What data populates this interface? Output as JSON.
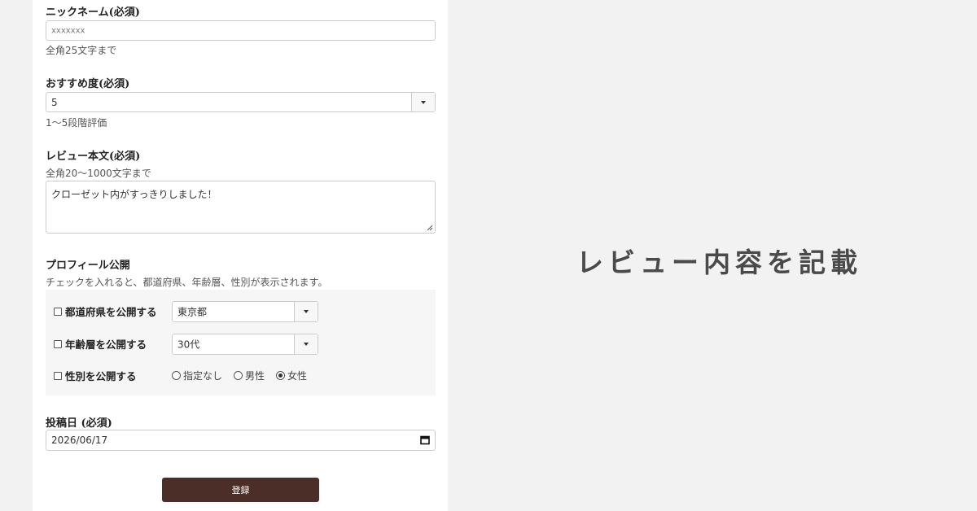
{
  "form": {
    "nickname": {
      "label": "ニックネーム(必須)",
      "placeholder": "xxxxxxx",
      "help": "全角25文字まで"
    },
    "rating": {
      "label": "おすすめ度(必須)",
      "value": "5",
      "help": "1〜5段階評価"
    },
    "review": {
      "label": "レビュー本文(必須)",
      "help": "全角20〜1000文字まで",
      "value": "クローゼット内がすっきりしました！"
    },
    "profile": {
      "label": "プロフィール公開",
      "help": "チェックを入れると、都道府県、年齢層、性別が表示されます。",
      "prefecture": {
        "label": "都道府県を公開する",
        "value": "東京都",
        "checked": false
      },
      "age": {
        "label": "年齢層を公開する",
        "value": "30代",
        "checked": false
      },
      "gender": {
        "label": "性別を公開する",
        "checked": false,
        "options": [
          "指定なし",
          "男性",
          "女性"
        ],
        "selected": "女性"
      }
    },
    "post_date": {
      "label": "投稿日 (必須)",
      "value": "2026/06/17"
    },
    "submit_label": "登録"
  },
  "headline": "レビュー内容を記載",
  "colors": {
    "page_background": "#f2f2f2",
    "panel_background": "#ffffff",
    "profile_box": "#f6f6f6",
    "submit_button": "#4a2e27",
    "headline_text": "#4a4a4a"
  }
}
